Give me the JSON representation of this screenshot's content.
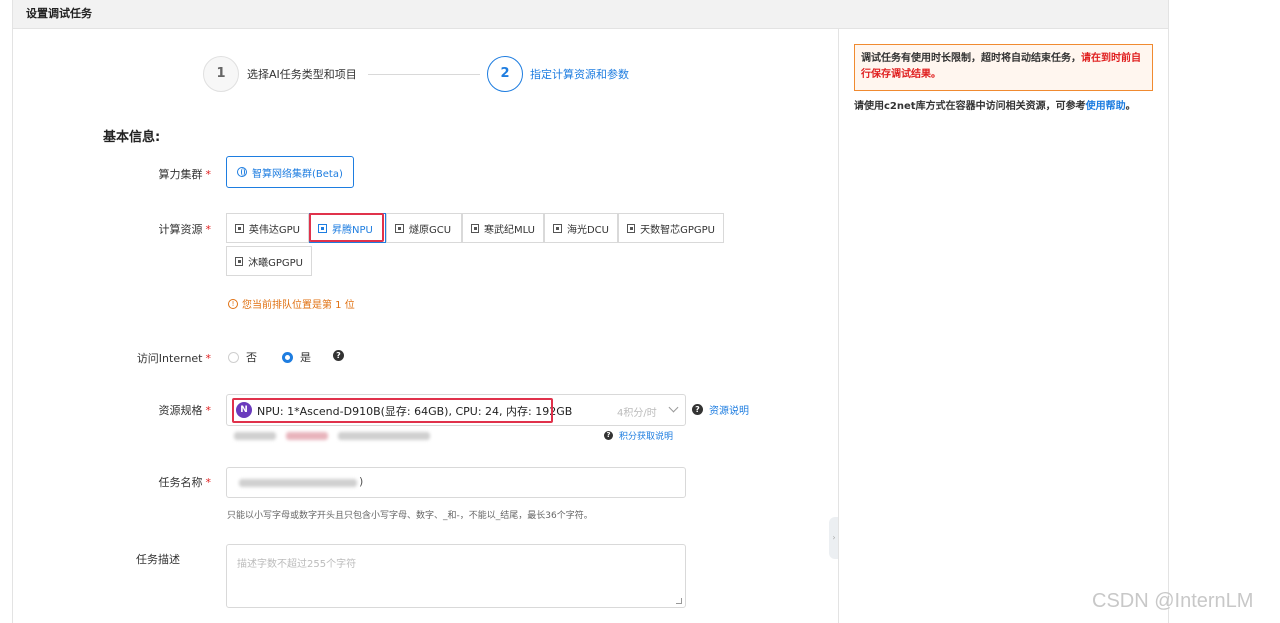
{
  "panel": {
    "title": "设置调试任务"
  },
  "steps": [
    {
      "number": "1",
      "label": "选择AI任务类型和项目"
    },
    {
      "number": "2",
      "label": "指定计算资源和参数"
    }
  ],
  "section_title": "基本信息:",
  "labels": {
    "cluster": "算力集群",
    "compute": "计算资源",
    "internet": "访问Internet",
    "spec": "资源规格",
    "task_name": "任务名称",
    "task_desc": "任务描述"
  },
  "cluster_button": "智算网络集群(Beta)",
  "compute_resources": [
    "英伟达GPU",
    "昇腾NPU",
    "燧原GCU",
    "寒武纪MLU",
    "海光DCU",
    "天数智芯GPGPU",
    "沐曦GPGPU"
  ],
  "queue_notice": "您当前排队位置是第 1 位",
  "internet_options": {
    "no": "否",
    "yes": "是",
    "selected": "是"
  },
  "spec": {
    "badge": "N",
    "value": "NPU: 1*Ascend-D910B(显存: 64GB), CPU: 24, 内存: 192GB",
    "rate": "4积分/时",
    "help_link": "资源说明",
    "points_link": "积分获取说明"
  },
  "task_name": {
    "tail_text": ")"
  },
  "task_name_hint": "只能以小写字母或数字开头且只包含小写字母、数字、_和-，不能以_结尾，最长36个字符。",
  "task_desc_placeholder": "描述字数不超过255个字符",
  "side": {
    "notice_text": "调试任务有使用时长限制，超时将自动结束任务，",
    "notice_red": "请在到时前自行保存调试结果。",
    "info_text": "请使用c2net库方式在容器中访问相关资源，可参考",
    "info_link": "使用帮助",
    "info_end": "。"
  },
  "watermark": "CSDN @InternLM",
  "colors": {
    "accent": "#1e7de0",
    "highlight": "#e0324b",
    "warning": "#e07010",
    "required": "#e02020"
  }
}
